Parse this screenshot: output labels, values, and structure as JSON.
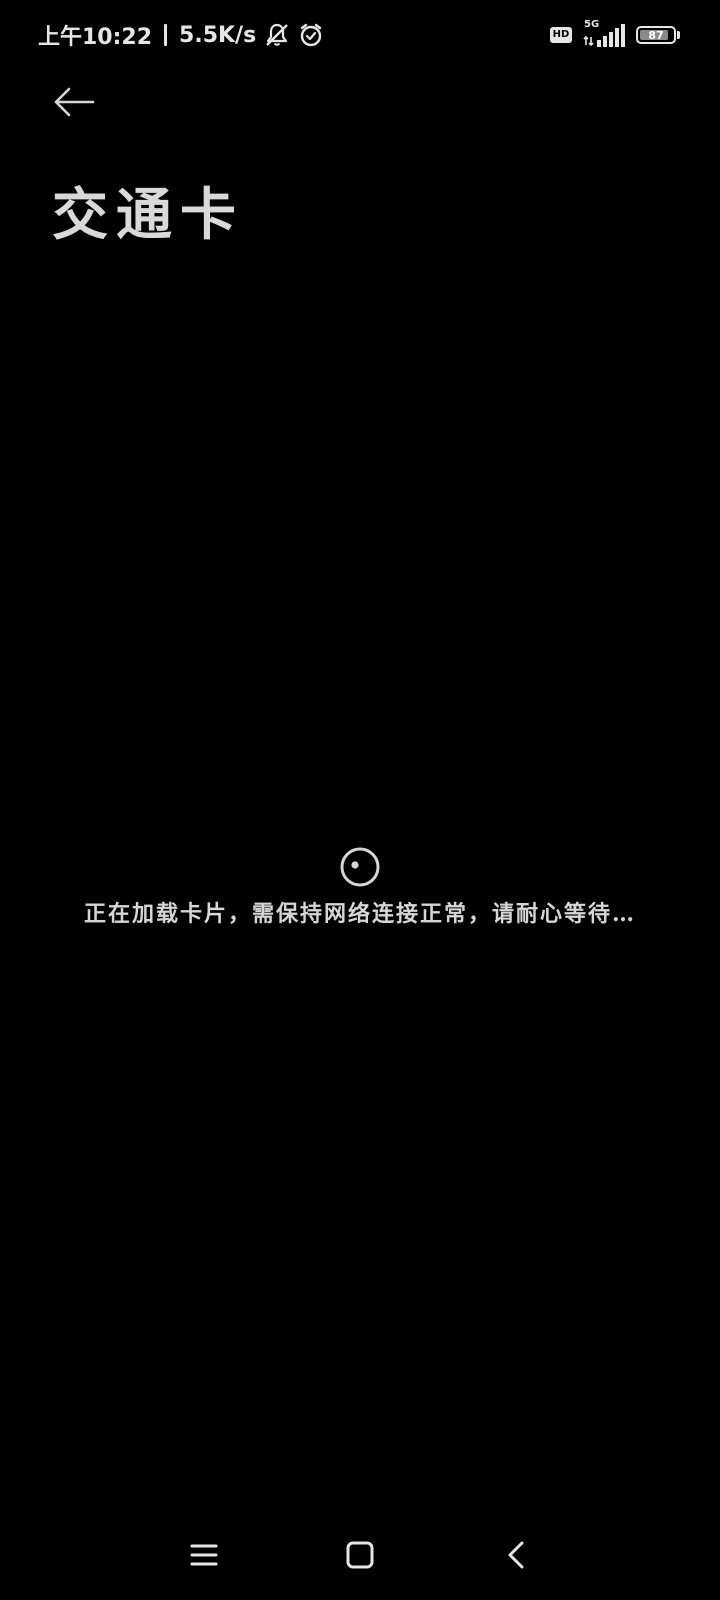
{
  "status_bar": {
    "time": "上午10:22",
    "net_speed": "5.5K/s",
    "network_type": "5G",
    "hd_label": "HD",
    "battery_level": "87",
    "battery_fraction": 0.87,
    "icons": [
      "bell-muted-icon",
      "alarm-clock-icon",
      "hd-icon",
      "signal-5g-icon",
      "battery-icon"
    ]
  },
  "header": {
    "back_icon": "arrow-left-icon",
    "title": "交通卡"
  },
  "loading": {
    "spinner_icon": "loading-spinner-icon",
    "message": "正在加载卡片，需保持网络连接正常，请耐心等待…"
  },
  "nav_bar": {
    "menu_icon": "menu-icon",
    "home_icon": "home-icon",
    "back_icon": "back-chevron-icon"
  },
  "colors": {
    "background": "#000000",
    "text": "#d6d6d6",
    "status": "#e6e6e6"
  }
}
